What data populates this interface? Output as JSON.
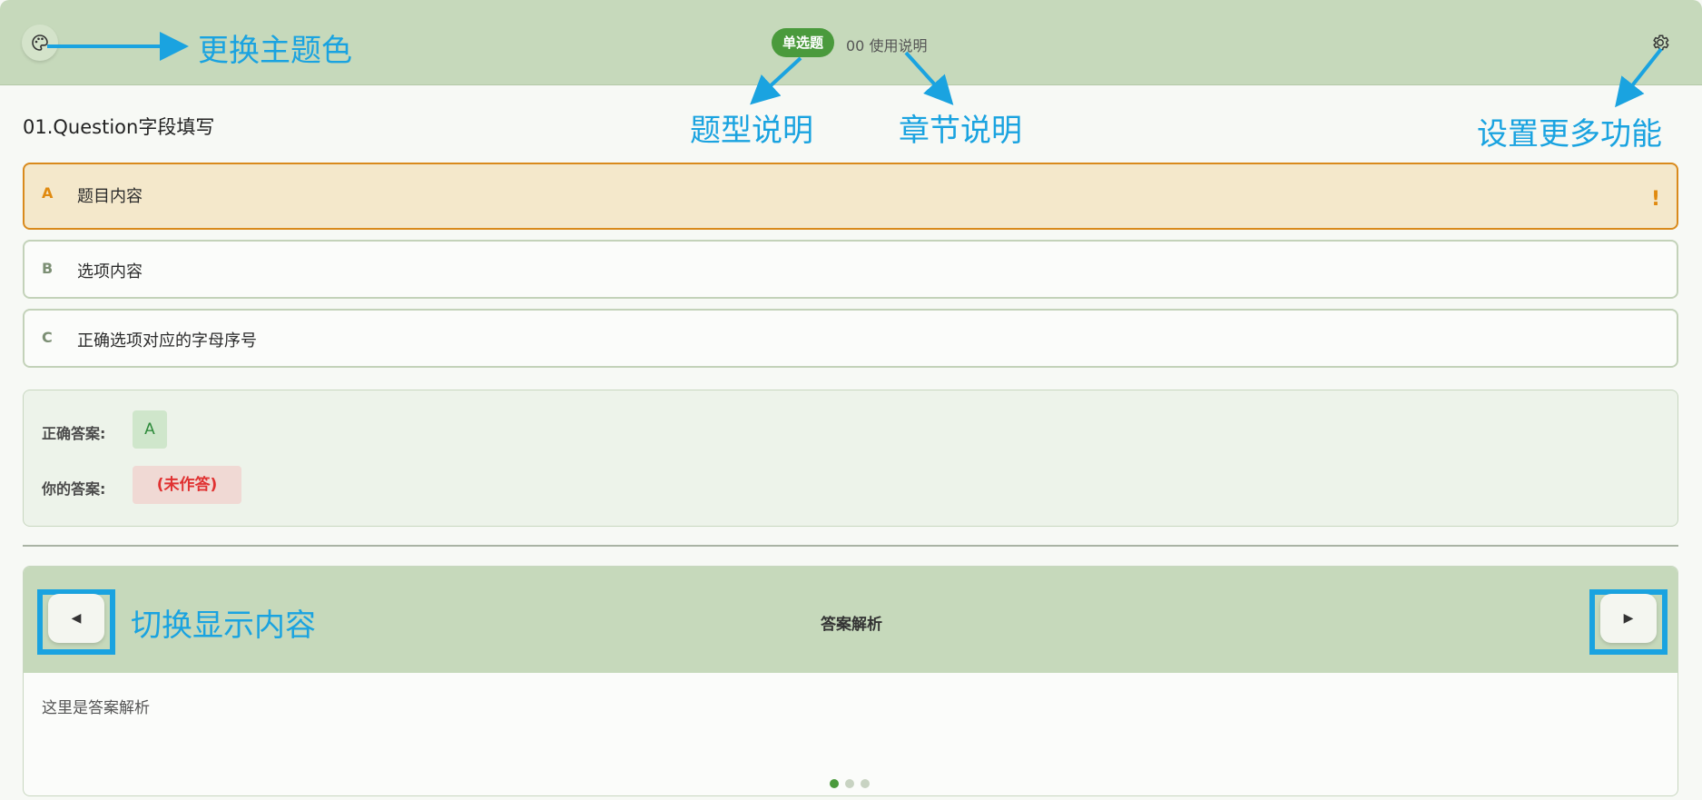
{
  "header": {
    "type_badge": "单选题",
    "chapter": "00 使用说明"
  },
  "annotations": {
    "theme": "更换主题色",
    "type_desc": "题型说明",
    "chapter_desc": "章节说明",
    "settings_desc": "设置更多功能",
    "switch_desc": "切换显示内容"
  },
  "question": {
    "title": "01.Question字段填写",
    "options": [
      {
        "letter": "A",
        "text": "题目内容",
        "selected": true
      },
      {
        "letter": "B",
        "text": "选项内容",
        "selected": false
      },
      {
        "letter": "C",
        "text": "正确选项对应的字母序号",
        "selected": false
      }
    ],
    "warn_mark": "!"
  },
  "answer": {
    "correct_label": "正确答案:",
    "correct_value": "A",
    "yours_label": "你的答案:",
    "yours_value": "(未作答)"
  },
  "panel": {
    "title": "答案解析",
    "body": "这里是答案解析",
    "prev_glyph": "◀",
    "next_glyph": "▶",
    "page_count": 3,
    "active_page": 1
  },
  "colors": {
    "header_bg": "#c6d9bb",
    "accent_green": "#4a9a3c",
    "selected_bg": "#f4e8cb",
    "selected_border": "#d98a1c",
    "annotation_blue": "#1aa3e0",
    "unanswered_red": "#e03131"
  },
  "icons": {
    "theme_button": "palette-icon",
    "settings_button": "gear-icon"
  }
}
